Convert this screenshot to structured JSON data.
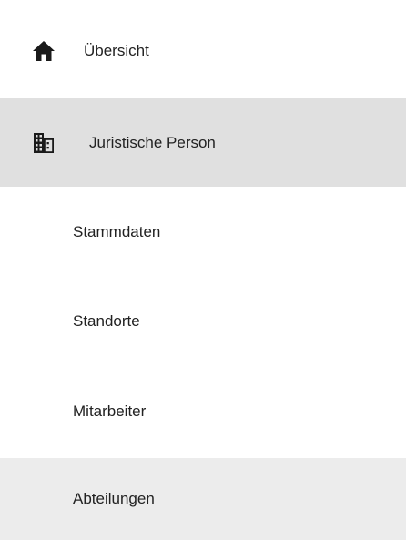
{
  "nav": {
    "overview": {
      "label": "Übersicht",
      "icon": "home-icon"
    },
    "legal_entity": {
      "label": "Juristische Person",
      "icon": "building-icon"
    },
    "sub_items": [
      {
        "label": "Stammdaten"
      },
      {
        "label": "Standorte"
      },
      {
        "label": "Mitarbeiter"
      },
      {
        "label": "Abteilungen"
      }
    ]
  },
  "colors": {
    "active_bg": "#e0e0e0",
    "hover_bg": "#ececec",
    "text": "#222222"
  }
}
